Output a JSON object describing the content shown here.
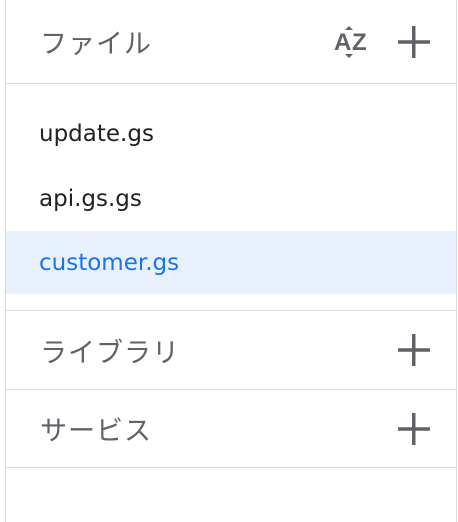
{
  "files": {
    "title": "ファイル",
    "sort_icon": "sort-az-icon",
    "add_icon": "plus-icon",
    "items": [
      {
        "label": "update.gs",
        "selected": false
      },
      {
        "label": "api.gs.gs",
        "selected": false
      },
      {
        "label": "customer.gs",
        "selected": true
      }
    ]
  },
  "libraries": {
    "title": "ライブラリ",
    "add_icon": "plus-icon"
  },
  "services": {
    "title": "サービス",
    "add_icon": "plus-icon"
  },
  "colors": {
    "header_text": "#5f6368",
    "file_text": "#202124",
    "selected_bg": "#e8f0fe",
    "selected_text": "#1a73e8",
    "divider": "#dadce0",
    "icon": "#5f6368"
  }
}
